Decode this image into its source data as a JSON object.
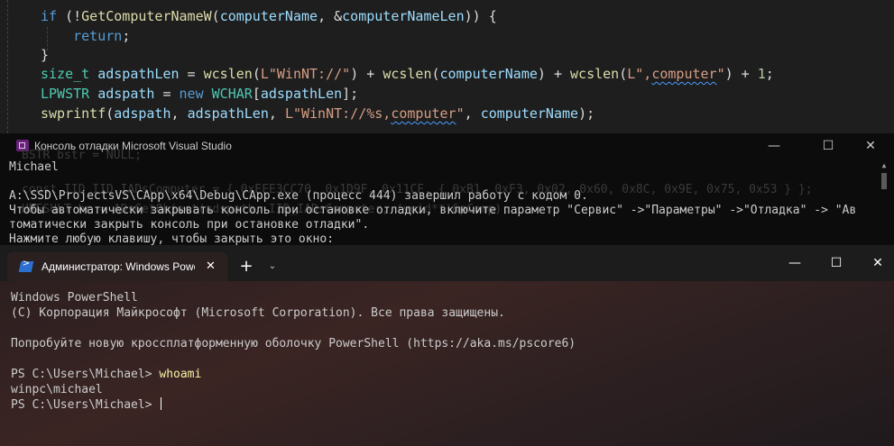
{
  "editor": {
    "lines": [
      {
        "parts": [
          [
            "kw",
            "if"
          ],
          [
            "p",
            " (!"
          ],
          [
            "fn",
            "GetComputerNameW"
          ],
          [
            "p",
            "("
          ],
          [
            "var",
            "computerName"
          ],
          [
            "p",
            ", &"
          ],
          [
            "var",
            "computerNameLen"
          ],
          [
            "p",
            ")) {"
          ]
        ]
      },
      {
        "parts": [
          [
            "p",
            "    "
          ],
          [
            "kw",
            "return"
          ],
          [
            "p",
            ";"
          ]
        ]
      },
      {
        "parts": [
          [
            "p",
            "}"
          ]
        ]
      },
      {
        "parts": [
          [
            "ty",
            "size_t"
          ],
          [
            "p",
            " "
          ],
          [
            "var",
            "adspathLen"
          ],
          [
            "p",
            " = "
          ],
          [
            "fn",
            "wcslen"
          ],
          [
            "p",
            "("
          ],
          [
            "str",
            "L\"WinNT://\""
          ],
          [
            "p",
            ") + "
          ],
          [
            "fn",
            "wcslen"
          ],
          [
            "p",
            "("
          ],
          [
            "var",
            "computerName"
          ],
          [
            "p",
            ") + "
          ],
          [
            "fn",
            "wcslen"
          ],
          [
            "p",
            "("
          ],
          [
            "str",
            "L\","
          ],
          [
            "sq",
            "computer"
          ],
          [
            "str",
            "\""
          ],
          [
            "p",
            ") + "
          ],
          [
            "num",
            "1"
          ],
          [
            "p",
            ";"
          ]
        ]
      },
      {
        "parts": [
          [
            "ty",
            "LPWSTR"
          ],
          [
            "p",
            " "
          ],
          [
            "var",
            "adspath"
          ],
          [
            "p",
            " = "
          ],
          [
            "kw",
            "new"
          ],
          [
            "p",
            " "
          ],
          [
            "ty",
            "WCHAR"
          ],
          [
            "p",
            "["
          ],
          [
            "var",
            "adspathLen"
          ],
          [
            "p",
            "];"
          ]
        ]
      },
      {
        "parts": [
          [
            "fn",
            "swprintf"
          ],
          [
            "p",
            "("
          ],
          [
            "var",
            "adspath"
          ],
          [
            "p",
            ", "
          ],
          [
            "var",
            "adspathLen"
          ],
          [
            "p",
            ", "
          ],
          [
            "str",
            "L\"WinNT://%s,"
          ],
          [
            "sq",
            "computer"
          ],
          [
            "str",
            "\""
          ],
          [
            "p",
            ", "
          ],
          [
            "var",
            "computerName"
          ],
          [
            "p",
            ");"
          ]
        ]
      }
    ]
  },
  "debug_console": {
    "title": "Консоль отладки Microsoft Visual Studio",
    "minimize": "—",
    "maximize": "☐",
    "close": "✕",
    "ghost_lines": [
      "BSTR bstr = NULL;",
      "const IID IID_IADsComputer = { 0xEFE3CC70, 0x1D9F, 0x11CF, { 0xB1, 0xF3, 0x02, 0x60, 0x8C, 0x9E, 0x75, 0x53 } };",
      "HRESULT hr = ADsGetObject(adspath, IID_IADsComputer, (void**)&pComp);"
    ],
    "lines": [
      "Michael",
      "",
      "A:\\SSD\\ProjectsVS\\CApp\\x64\\Debug\\CApp.exe (процесс 444) завершил работу с кодом 0.",
      "Чтобы автоматически закрывать консоль при остановке отладки, включите параметр \"Сервис\" ->\"Параметры\" ->\"Отладка\" -> \"Ав",
      "томатически закрыть консоль при остановке отладки\".",
      "Нажмите любую клавишу, чтобы закрыть это окно:"
    ]
  },
  "terminal": {
    "tab_title": "Администратор: Windows PowerShell",
    "tab_close": "✕",
    "new_tab": "+",
    "dropdown": "⌄",
    "minimize": "—",
    "maximize": "☐",
    "close": "✕",
    "lines": [
      {
        "text": "Windows PowerShell"
      },
      {
        "text": "(C) Корпорация Майкрософт (Microsoft Corporation). Все права защищены."
      },
      {
        "text": ""
      },
      {
        "text": "Попробуйте новую кроссплатформенную оболочку PowerShell (https://aka.ms/pscore6)"
      },
      {
        "text": ""
      },
      {
        "prompt": "PS C:\\Users\\Michael> ",
        "command": "whoami"
      },
      {
        "text": "winpc\\michael"
      },
      {
        "prompt": "PS C:\\Users\\Michael> ",
        "command": "",
        "cursor": true
      }
    ]
  }
}
